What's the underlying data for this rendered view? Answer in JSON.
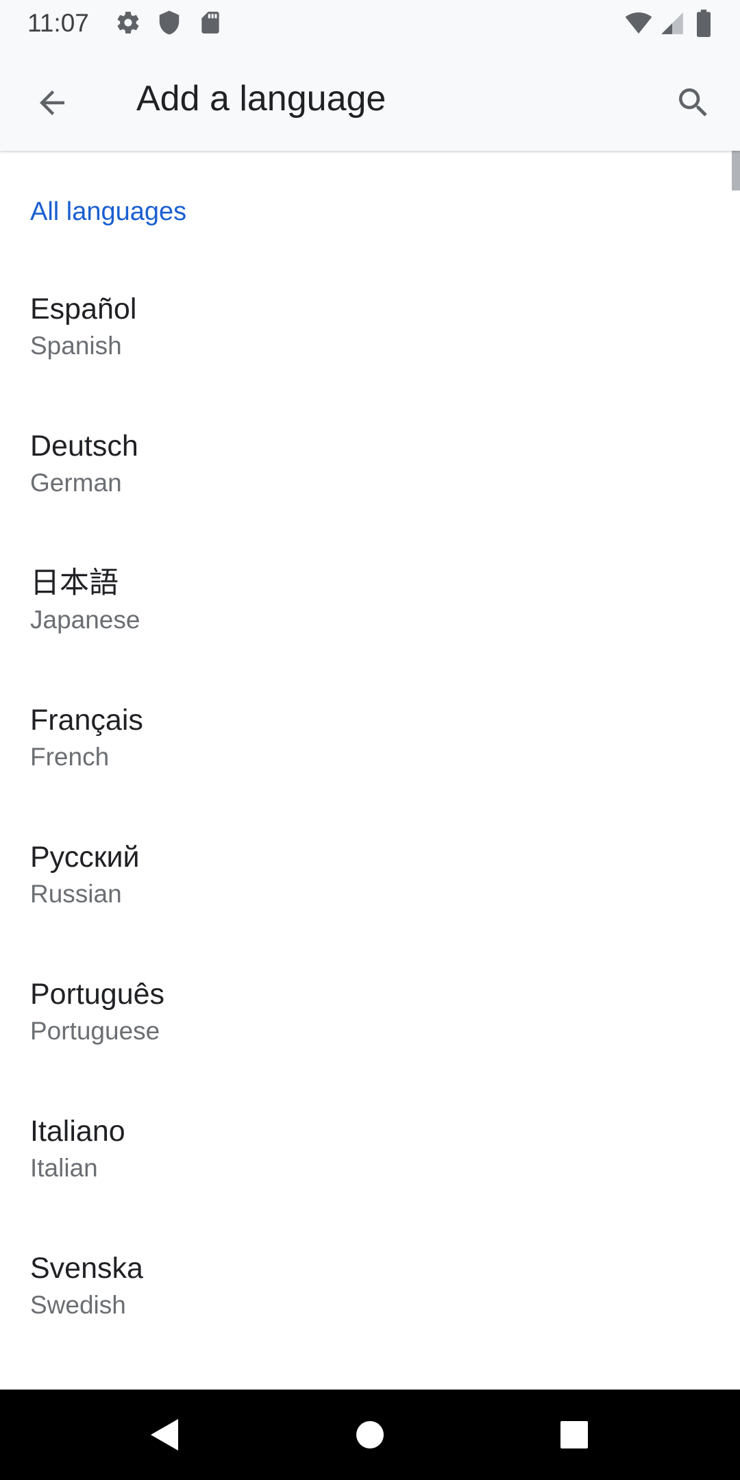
{
  "status_bar": {
    "time": "11:07",
    "left_icons": [
      "settings-icon",
      "shield-icon",
      "sd-card-icon"
    ],
    "right_icons": [
      "wifi-icon",
      "signal-icon",
      "battery-icon"
    ]
  },
  "app_bar": {
    "title": "Add a language",
    "back_icon": "arrow-back-icon",
    "search_icon": "search-icon"
  },
  "section": {
    "header": "All languages"
  },
  "languages": [
    {
      "native": "Español",
      "english": "Spanish"
    },
    {
      "native": "Deutsch",
      "english": "German"
    },
    {
      "native": "日本語",
      "english": "Japanese"
    },
    {
      "native": "Français",
      "english": "French"
    },
    {
      "native": "Русский",
      "english": "Russian"
    },
    {
      "native": "Português",
      "english": "Portuguese"
    },
    {
      "native": "Italiano",
      "english": "Italian"
    },
    {
      "native": "Svenska",
      "english": "Swedish"
    }
  ],
  "nav_bar": {
    "icons": [
      "back-triangle-icon",
      "home-circle-icon",
      "recents-square-icon"
    ]
  },
  "colors": {
    "accent": "#1a5fd0",
    "app_bar_bg": "#f8f9fb",
    "primary_text": "#202124",
    "secondary_text": "#6b6e72",
    "nav_bar_bg": "#000000"
  }
}
